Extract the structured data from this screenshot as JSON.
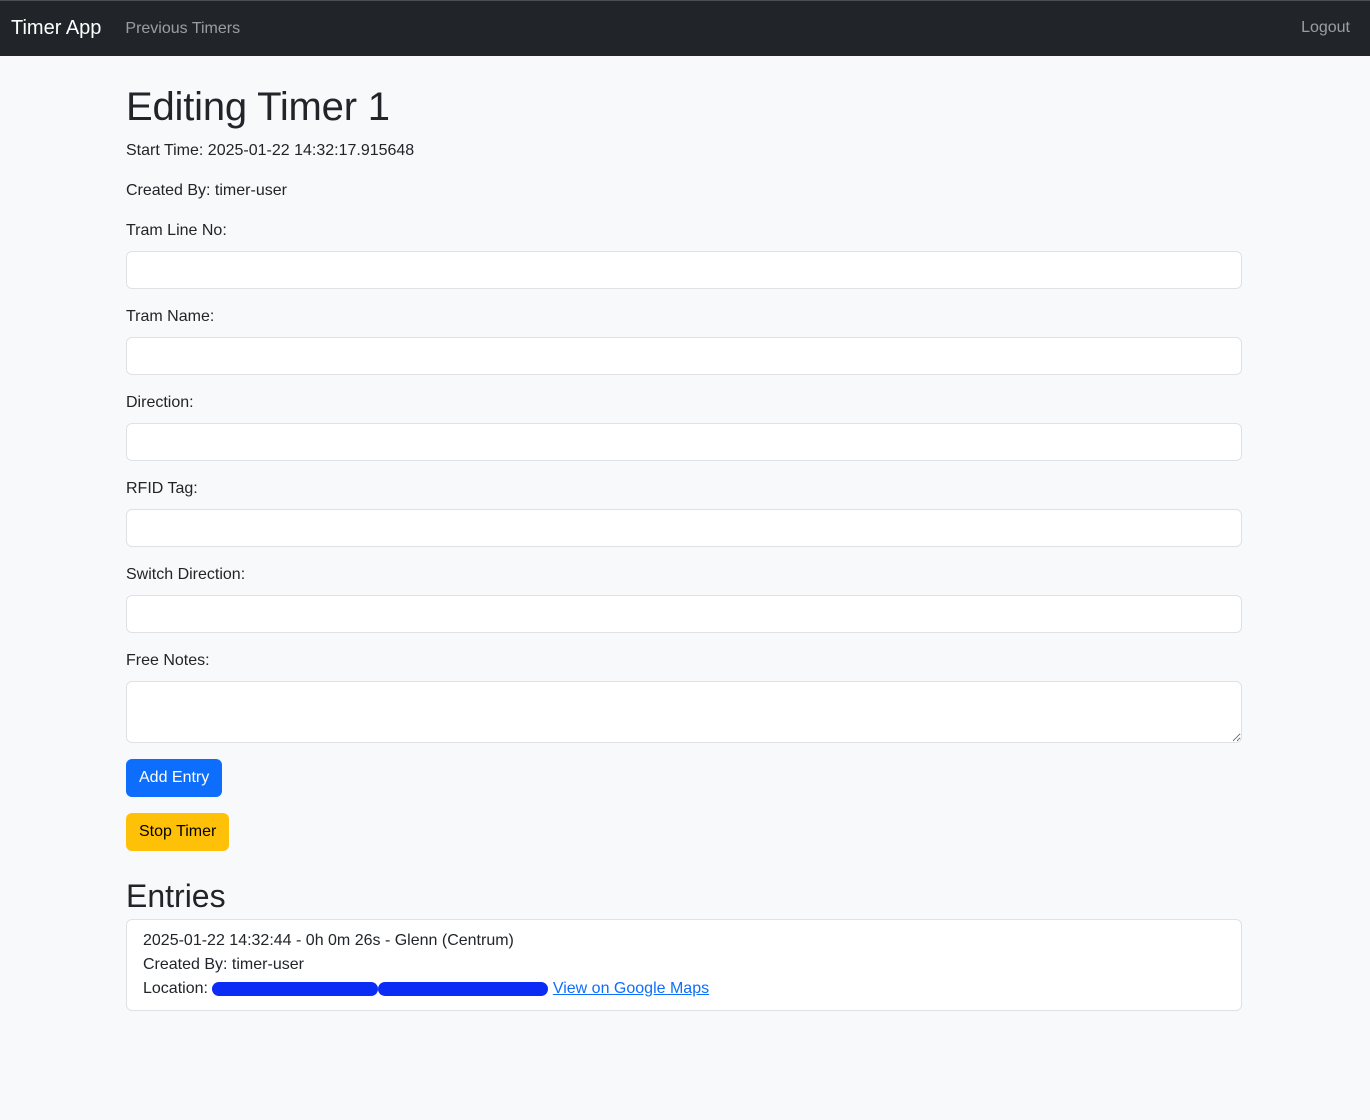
{
  "navbar": {
    "brand": "Timer App",
    "links": [
      {
        "label": "Previous Timers"
      }
    ],
    "logout": "Logout"
  },
  "page": {
    "title": "Editing Timer 1",
    "start_time": "Start Time: 2025-01-22 14:32:17.915648",
    "created_by": "Created By: timer-user"
  },
  "form": {
    "tram_line_label": "Tram Line No:",
    "tram_line_value": "",
    "tram_name_label": "Tram Name:",
    "tram_name_value": "",
    "direction_label": "Direction:",
    "direction_value": "",
    "rfid_label": "RFID Tag:",
    "rfid_value": "",
    "switch_direction_label": "Switch Direction:",
    "switch_direction_value": "",
    "free_notes_label": "Free Notes:",
    "free_notes_value": "",
    "add_entry_label": "Add Entry",
    "stop_timer_label": "Stop Timer"
  },
  "entries": {
    "heading": "Entries",
    "items": [
      {
        "summary": "2025-01-22 14:32:44 - 0h 0m 26s - Glenn (Centrum)",
        "created_by": "Created By: timer-user",
        "location_label": "Location:",
        "maps_link": "View on Google Maps"
      }
    ]
  },
  "colors": {
    "navbar_bg": "#212529",
    "primary": "#0d6efd",
    "warning": "#ffc107",
    "redaction": "#0b2cf5"
  }
}
